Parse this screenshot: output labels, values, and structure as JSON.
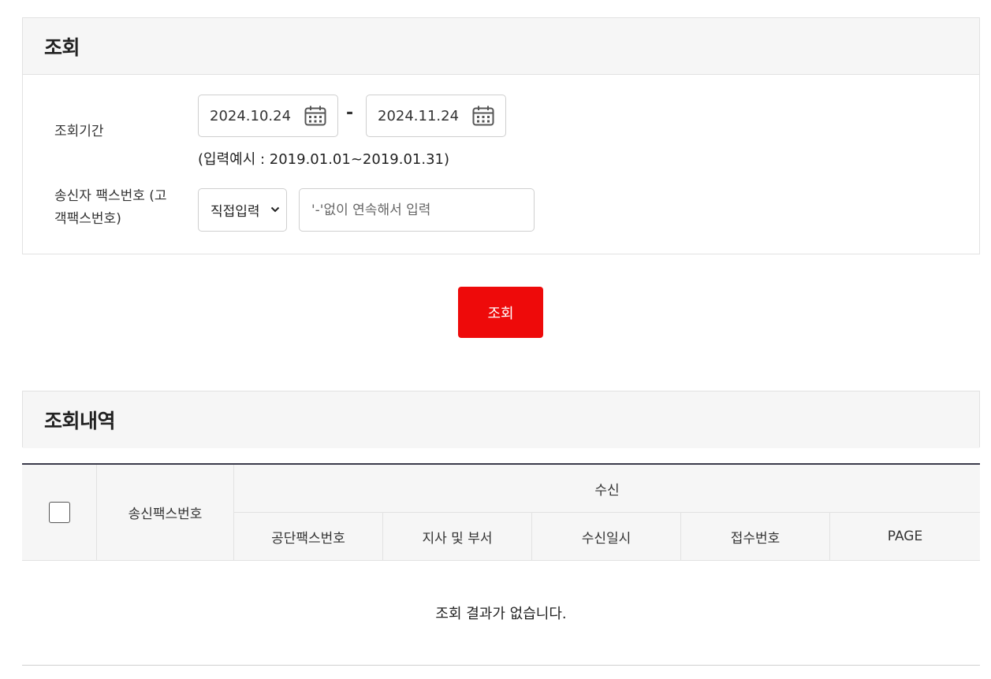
{
  "search": {
    "title": "조회",
    "period_label": "조회기간",
    "start_date": "2024.10.24",
    "end_date": "2024.11.24",
    "separator": "-",
    "example": "(입력예시 : 2019.01.01~2019.01.31)",
    "fax_label_line1": "송신자 팩스번호 (고",
    "fax_label_line2": "객팩스번호)",
    "select_value": "직접입력",
    "fax_placeholder": "'-'없이 연속해서 입력",
    "button_label": "조회"
  },
  "results": {
    "title": "조회내역",
    "columns": {
      "sender_fax": "송신팩스번호",
      "receive_group": "수신",
      "agency_fax": "공단팩스번호",
      "branch": "지사 및 부서",
      "received_at": "수신일시",
      "receipt_no": "접수번호",
      "page": "PAGE"
    },
    "empty_message": "조회 결과가 없습니다."
  },
  "icons": {
    "date_picker": "calendar-icon",
    "select_arrow": "chevron-down-icon"
  },
  "colors": {
    "primary_button": "#ee0a0a",
    "header_bg": "#f6f6f6",
    "table_top_border": "#3a3a4a"
  }
}
